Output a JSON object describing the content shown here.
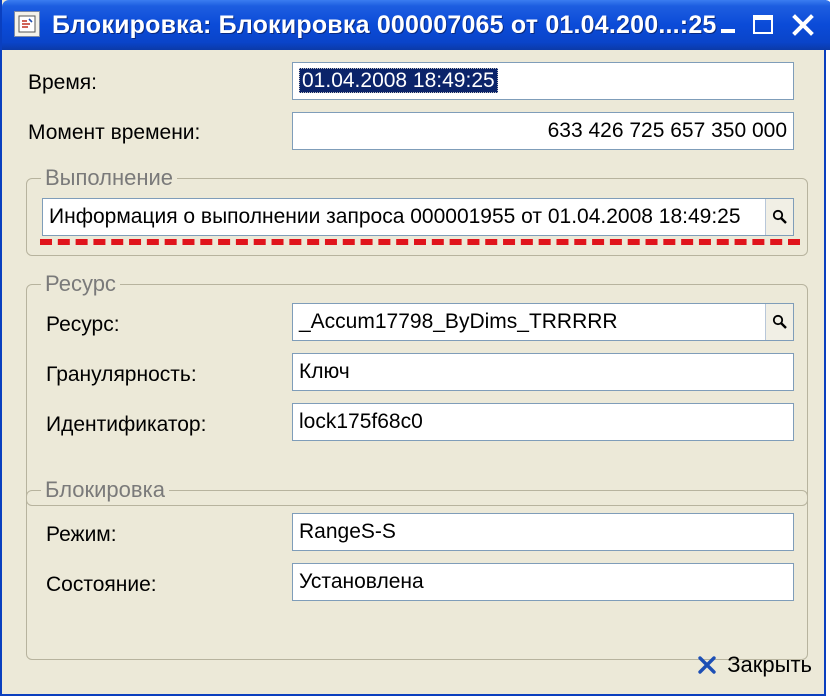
{
  "window": {
    "title": "Блокировка: Блокировка 000007065 от 01.04.200...:25",
    "icon": "form-icon",
    "controls": [
      "minimize-icon",
      "maximize-icon",
      "close-icon"
    ]
  },
  "fields": {
    "time_label": "Время:",
    "time_value": "01.04.2008 18:49:25",
    "moment_label": "Момент времени:",
    "moment_value": "633 426 725 657 350 000"
  },
  "execution": {
    "title": "Выполнение",
    "value": "Информация о выполнении запроса 000001955 от 01.04.2008 18:49:25"
  },
  "resource": {
    "title": "Ресурс",
    "resource_label": "Ресурс:",
    "resource_value": "_Accum17798_ByDims_TRRRRR",
    "granularity_label": "Гранулярность:",
    "granularity_value": "Ключ",
    "id_label": "Идентификатор:",
    "id_value": "lock175f68c0"
  },
  "lock": {
    "title": "Блокировка",
    "mode_label": "Режим:",
    "mode_value": "RangeS-S",
    "state_label": "Состояние:",
    "state_value": "Установлена"
  },
  "footer": {
    "close_label": "Закрыть"
  },
  "colors": {
    "titlebar": "#0b4bd8",
    "window_bg": "#ece9d8",
    "selection": "#0b246a",
    "annotation_red": "#e0141c",
    "close_x": "#1d4fb5"
  }
}
